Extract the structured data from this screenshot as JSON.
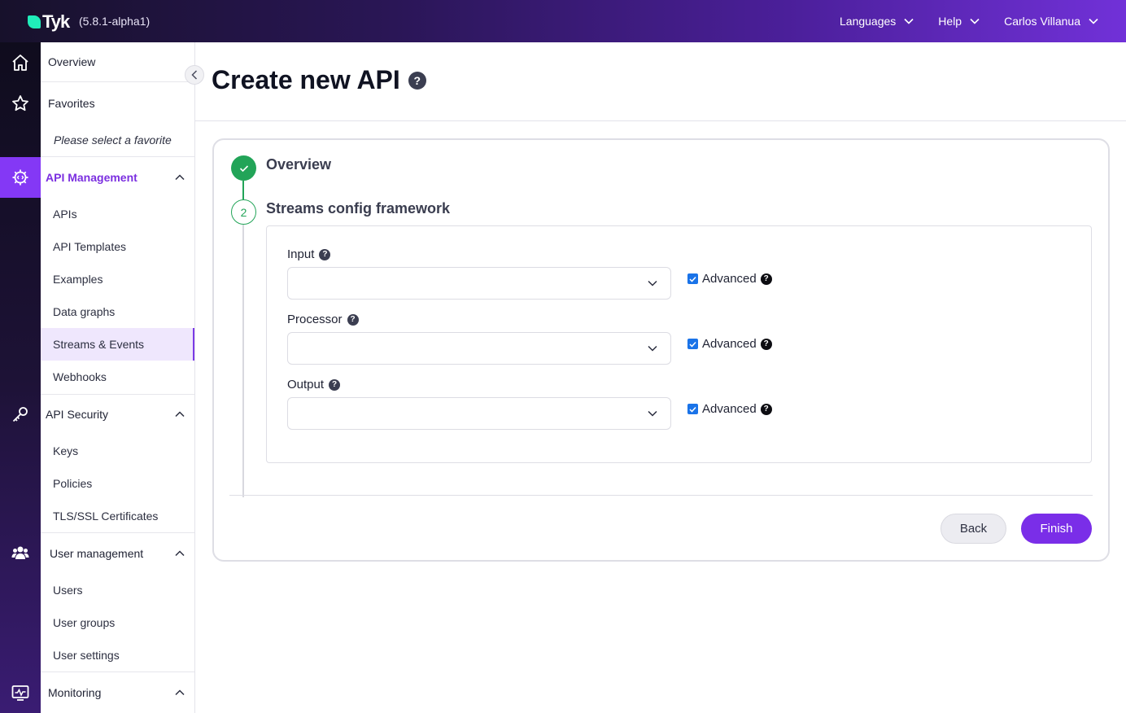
{
  "topbar": {
    "brand": "Tyk",
    "version": "(5.8.1-alpha1)",
    "nav": [
      {
        "label": "Languages"
      },
      {
        "label": "Help"
      },
      {
        "label": "Carlos Villanua"
      }
    ]
  },
  "rail": {
    "icons": [
      "home-icon",
      "star-icon",
      "api-gear-icon",
      "key-icon",
      "users-icon",
      "monitor-icon"
    ]
  },
  "sidebar": {
    "overview": "Overview",
    "favorites": "Favorites",
    "favorites_placeholder": "Please select a favorite",
    "api_management": {
      "label": "API Management",
      "items": [
        "APIs",
        "API Templates",
        "Examples",
        "Data graphs",
        "Streams & Events",
        "Webhooks"
      ],
      "active": "Streams & Events"
    },
    "api_security": {
      "label": "API Security",
      "items": [
        "Keys",
        "Policies",
        "TLS/SSL Certificates"
      ]
    },
    "user_management": {
      "label": "User management",
      "items": [
        "Users",
        "User groups",
        "User settings"
      ]
    },
    "monitoring": {
      "label": "Monitoring"
    }
  },
  "main": {
    "title": "Create new API",
    "steps": [
      {
        "label": "Overview",
        "status": "done"
      },
      {
        "label": "Streams config framework",
        "number": "2",
        "status": "current"
      }
    ],
    "fields": [
      {
        "label": "Input",
        "value": "",
        "advanced_label": "Advanced",
        "advanced_checked": true
      },
      {
        "label": "Processor",
        "value": "",
        "advanced_label": "Advanced",
        "advanced_checked": true
      },
      {
        "label": "Output",
        "value": "",
        "advanced_label": "Advanced",
        "advanced_checked": true
      }
    ],
    "buttons": {
      "back": "Back",
      "finish": "Finish"
    }
  },
  "colors": {
    "accent": "#7a2ee8",
    "success": "#22a458",
    "checkbox": "#1a73e8"
  }
}
